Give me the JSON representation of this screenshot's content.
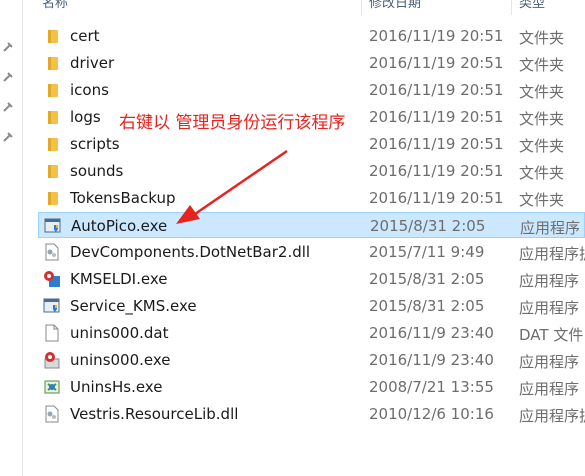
{
  "header": {
    "name": "名称",
    "date": "修改日期",
    "type": "类型"
  },
  "annotation": "右键以 管理员身份运行该程序",
  "colors": {
    "accent": "#e8231f",
    "selection": "#cce8ff",
    "folder": "#f5c046"
  },
  "files": [
    {
      "icon": "folder-icon",
      "name": "cert",
      "date": "2016/11/19 20:51",
      "type": "文件夹"
    },
    {
      "icon": "folder-icon",
      "name": "driver",
      "date": "2016/11/19 20:51",
      "type": "文件夹"
    },
    {
      "icon": "folder-icon",
      "name": "icons",
      "date": "2016/11/19 20:51",
      "type": "文件夹"
    },
    {
      "icon": "folder-icon",
      "name": "logs",
      "date": "2016/11/19 20:51",
      "type": "文件夹"
    },
    {
      "icon": "folder-icon",
      "name": "scripts",
      "date": "2016/11/19 20:51",
      "type": "文件夹"
    },
    {
      "icon": "folder-icon",
      "name": "sounds",
      "date": "2016/11/19 20:51",
      "type": "文件夹"
    },
    {
      "icon": "folder-icon",
      "name": "TokensBackup",
      "date": "2016/11/19 20:51",
      "type": "文件夹"
    },
    {
      "icon": "exe-shield-icon",
      "name": "AutoPico.exe",
      "date": "2015/8/31 2:05",
      "type": "应用程序"
    },
    {
      "icon": "dll-icon",
      "name": "DevComponents.DotNetBar2.dll",
      "date": "2015/7/11 9:49",
      "type": "应用程序扩"
    },
    {
      "icon": "kmseldi-icon",
      "name": "KMSELDI.exe",
      "date": "2015/8/31 2:05",
      "type": "应用程序"
    },
    {
      "icon": "exe-shield-icon",
      "name": "Service_KMS.exe",
      "date": "2015/8/31 2:05",
      "type": "应用程序"
    },
    {
      "icon": "file-icon",
      "name": "unins000.dat",
      "date": "2016/11/9 23:40",
      "type": "DAT 文件"
    },
    {
      "icon": "uninstall-icon",
      "name": "unins000.exe",
      "date": "2016/11/9 23:40",
      "type": "应用程序"
    },
    {
      "icon": "unins-hs-icon",
      "name": "UninsHs.exe",
      "date": "2008/7/21 13:55",
      "type": "应用程序"
    },
    {
      "icon": "dll-icon",
      "name": "Vestris.ResourceLib.dll",
      "date": "2010/12/6 10:16",
      "type": "应用程序扩"
    }
  ]
}
